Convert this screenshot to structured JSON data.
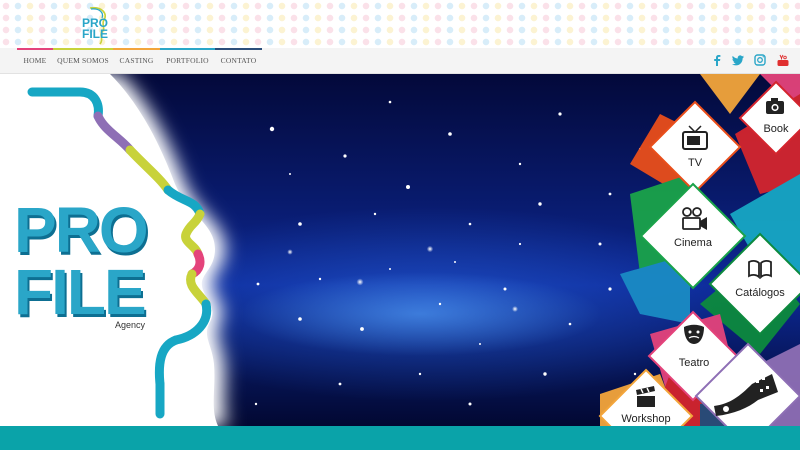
{
  "header": {
    "logo_line1": "PRO",
    "logo_line2": "FILE"
  },
  "nav": {
    "items": [
      "HOME",
      "QUEM SOMOS",
      "CASTING",
      "PORTFOLIO",
      "CONTATO"
    ]
  },
  "social": [
    "facebook-icon",
    "twitter-icon",
    "instagram-icon",
    "youtube-icon"
  ],
  "hero": {
    "brand_line1": "PRO",
    "brand_line2": "FILE",
    "brand_sub": "Agency",
    "tiles": {
      "book": "Book",
      "tv": "TV",
      "cinema": "Cinema",
      "catalogos": "Catálogos",
      "teatro": "Teatro",
      "workshop": "Workshop"
    }
  },
  "colors": {
    "accent_teal": "#0aa3a9",
    "brand_blue": "#2aa6c8",
    "nav_pink": "#e4437b",
    "nav_lime": "#c8d23a",
    "nav_orange": "#f3a53b",
    "nav_navy": "#2c4e7a"
  }
}
